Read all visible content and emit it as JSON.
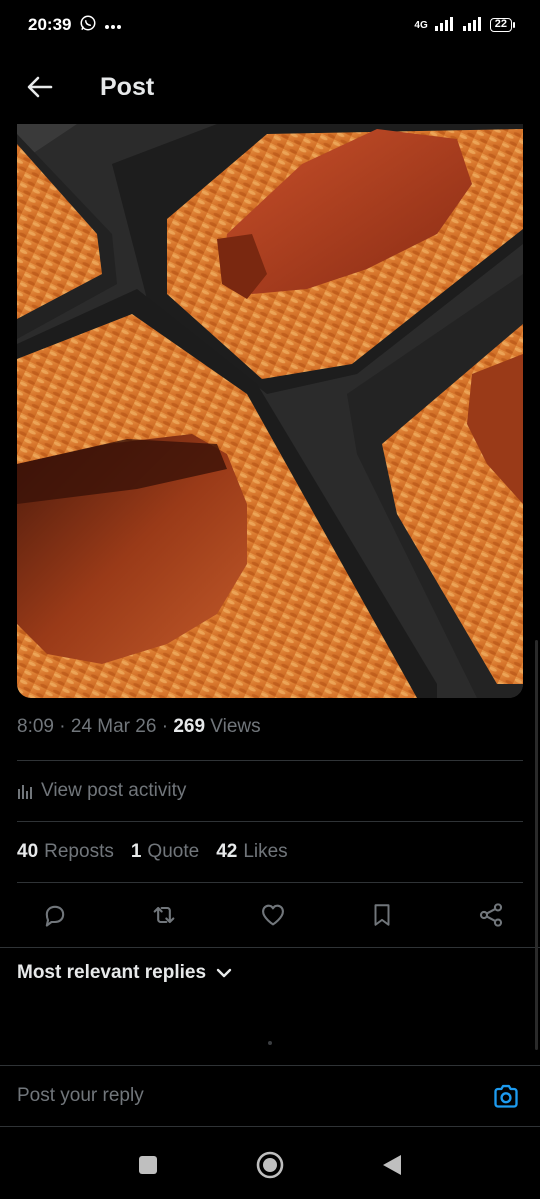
{
  "status_bar": {
    "time": "20:39",
    "network": "4G",
    "battery": "22",
    "icons": [
      "whatsapp-icon",
      "more-dots-icon",
      "signal-icon",
      "battery-icon"
    ]
  },
  "header": {
    "title": "Post",
    "back_icon": "arrow-left-icon"
  },
  "post": {
    "image_alt": "food-photo",
    "time": "8:09",
    "date": "24 Mar 26",
    "views_count": "269",
    "views_label": "Views",
    "activity_label": "View post activity",
    "reposts_count": "40",
    "reposts_label": "Reposts",
    "quotes_count": "1",
    "quotes_label": "Quote",
    "likes_count": "42",
    "likes_label": "Likes"
  },
  "actions": [
    "reply-icon",
    "repost-icon",
    "like-icon",
    "bookmark-icon",
    "share-icon"
  ],
  "replies": {
    "sort_label": "Most relevant replies"
  },
  "reply_bar": {
    "placeholder": "Post your reply",
    "camera_icon": "camera-icon"
  },
  "nav_bar": [
    "recents-square-icon",
    "home-circle-icon",
    "back-triangle-icon"
  ],
  "colors": {
    "background": "#000000",
    "text_primary": "#e7e9ea",
    "text_secondary": "#71767b",
    "divider": "#2f3336",
    "accent": "#1d9bf0"
  }
}
